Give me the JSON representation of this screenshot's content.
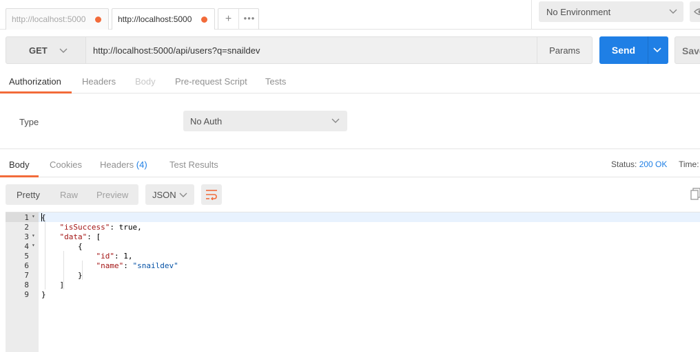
{
  "tabs": [
    {
      "title": "http://localhost:5000",
      "active": false,
      "modified": true
    },
    {
      "title": "http://localhost:5000",
      "active": true,
      "modified": true
    }
  ],
  "tab_actions": {
    "new_tab": "+",
    "more": "•••"
  },
  "environment": {
    "selected": "No Environment"
  },
  "request": {
    "method": "GET",
    "url": "http://localhost:5000/api/users?q=snaildev",
    "params_label": "Params",
    "send_label": "Send",
    "save_label": "Save"
  },
  "request_tabs": [
    "Authorization",
    "Headers",
    "Body",
    "Pre-request Script",
    "Tests"
  ],
  "auth": {
    "type_label": "Type",
    "selected": "No Auth"
  },
  "response_tabs": {
    "body": "Body",
    "cookies": "Cookies",
    "headers": "Headers",
    "headers_count": "(4)",
    "test_results": "Test Results"
  },
  "status": {
    "label": "Status:",
    "value": "200 OK",
    "time_label": "Time:"
  },
  "view_modes": [
    "Pretty",
    "Raw",
    "Preview"
  ],
  "format": {
    "selected": "JSON"
  },
  "response_body": {
    "line_numbers": [
      "1",
      "2",
      "3",
      "4",
      "5",
      "6",
      "7",
      "8",
      "9"
    ],
    "lines": [
      [
        {
          "t": "{",
          "c": "p"
        }
      ],
      [
        {
          "t": "    ",
          "c": "p"
        },
        {
          "t": "\"isSuccess\"",
          "c": "k"
        },
        {
          "t": ": true,",
          "c": "p"
        }
      ],
      [
        {
          "t": "    ",
          "c": "p"
        },
        {
          "t": "\"data\"",
          "c": "k"
        },
        {
          "t": ": [",
          "c": "p"
        }
      ],
      [
        {
          "t": "        {",
          "c": "p"
        }
      ],
      [
        {
          "t": "            ",
          "c": "p"
        },
        {
          "t": "\"id\"",
          "c": "k"
        },
        {
          "t": ": 1,",
          "c": "p"
        }
      ],
      [
        {
          "t": "            ",
          "c": "p"
        },
        {
          "t": "\"name\"",
          "c": "k"
        },
        {
          "t": ": ",
          "c": "p"
        },
        {
          "t": "\"snaildev\"",
          "c": "s"
        }
      ],
      [
        {
          "t": "        }",
          "c": "p"
        }
      ],
      [
        {
          "t": "    ]",
          "c": "p"
        }
      ],
      [
        {
          "t": "}",
          "c": "p"
        }
      ]
    ],
    "foldable": [
      true,
      false,
      true,
      true,
      false,
      false,
      false,
      false,
      false
    ]
  },
  "colors": {
    "accent": "#f26b3a",
    "send": "#1f7fe5",
    "status_ok": "#1f7fe5"
  },
  "icons": [
    "chevron-down-icon",
    "eye-icon",
    "wrap-lines-icon",
    "copy-icon"
  ]
}
